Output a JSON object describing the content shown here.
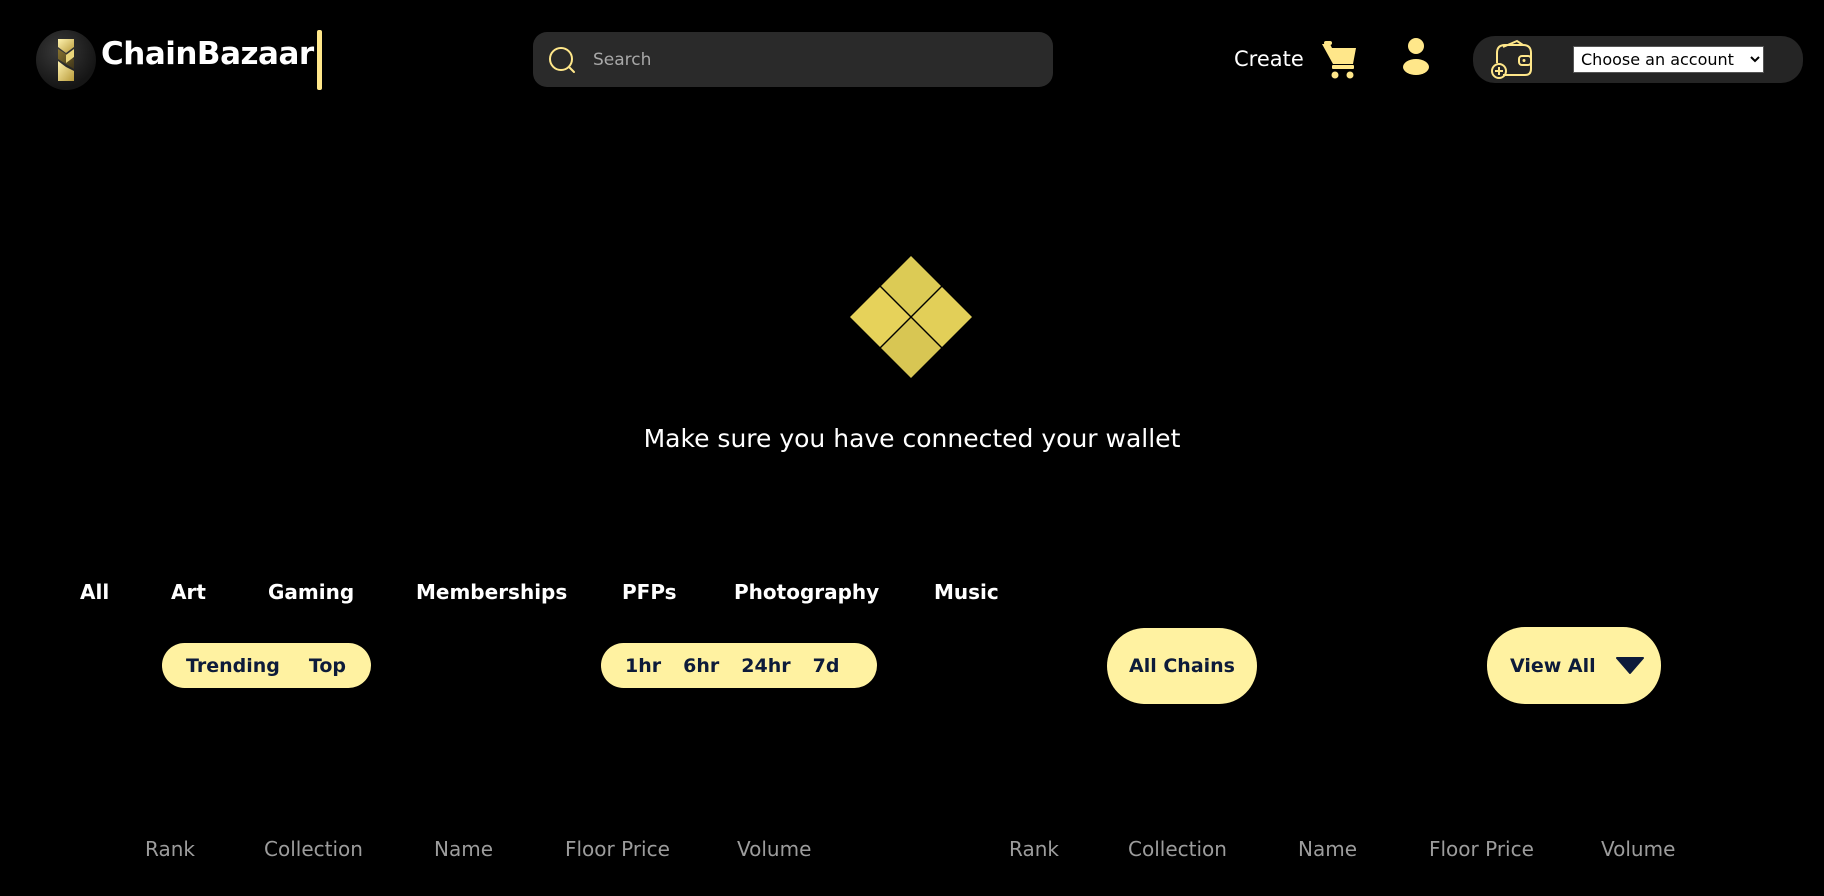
{
  "header": {
    "brand": "ChainBazaar",
    "search_placeholder": "Search",
    "create_label": "Create",
    "account_select": {
      "selected": "Choose an account",
      "options": [
        "Choose an account"
      ]
    }
  },
  "main": {
    "wallet_message": "Make sure you have connected your wallet"
  },
  "categories": [
    "All",
    "Art",
    "Gaming",
    "Memberships",
    "PFPs",
    "Photography",
    "Music"
  ],
  "filters": {
    "mode_options": [
      "Trending",
      "Top"
    ],
    "time_options": [
      "1hr",
      "6hr",
      "24hr",
      "7d"
    ],
    "chains_label": "All Chains",
    "view_all_label": "View All"
  },
  "tables": {
    "left_columns": [
      "Rank",
      "Collection",
      "Name",
      "Floor Price",
      "Volume"
    ],
    "right_columns": [
      "Rank",
      "Collection",
      "Name",
      "Floor Price",
      "Volume"
    ]
  },
  "colors": {
    "background": "#000000",
    "accent": "#fff2a1",
    "accent_text": "#0d1b3a",
    "icon_yellow": "#ffe78a",
    "search_bg": "#2a2a2a",
    "muted_text": "#9c9c9c"
  },
  "icons": {
    "logo": "chainbazaar-logo-icon",
    "search": "search-icon",
    "cart": "cart-icon",
    "user": "user-icon",
    "wallet": "wallet-icon",
    "hero": "diamond-logo-icon",
    "caret": "caret-down-icon"
  }
}
